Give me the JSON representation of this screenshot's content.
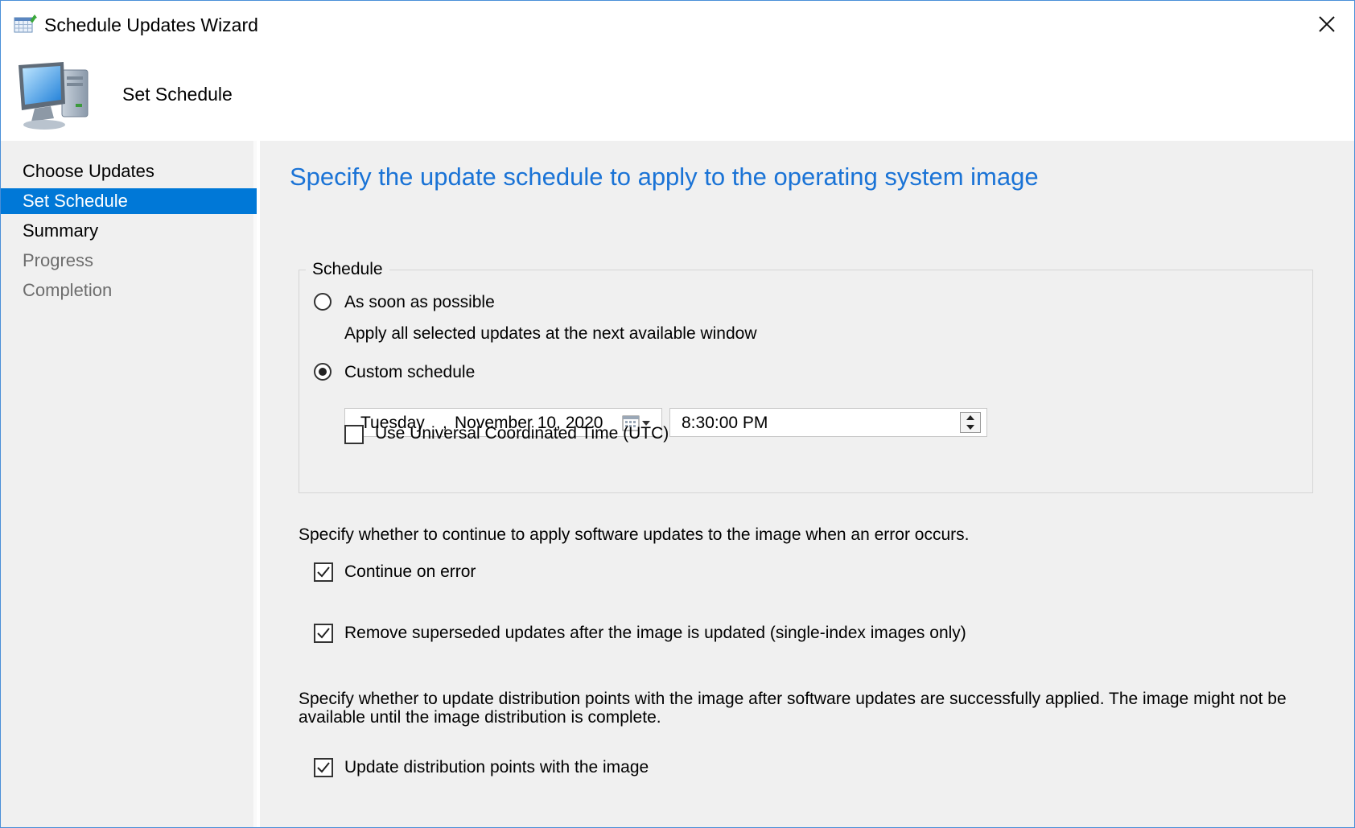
{
  "window": {
    "title": "Schedule Updates Wizard",
    "close_icon": "close-icon"
  },
  "header": {
    "title": "Set Schedule",
    "icon": "computer-icon"
  },
  "sidebar": {
    "items": [
      {
        "label": "Choose Updates",
        "state": "normal"
      },
      {
        "label": "Set Schedule",
        "state": "active"
      },
      {
        "label": "Summary",
        "state": "normal"
      },
      {
        "label": "Progress",
        "state": "disabled"
      },
      {
        "label": "Completion",
        "state": "disabled"
      }
    ]
  },
  "main": {
    "heading": "Specify the update schedule to apply to the operating system image",
    "schedule_group": {
      "legend": "Schedule",
      "asap_label": "As soon as possible",
      "asap_checked": false,
      "asap_description": "Apply all selected updates at the next available window",
      "custom_label": "Custom schedule",
      "custom_checked": true,
      "date": {
        "day": "Tuesday",
        "comma": ",",
        "rest": "November 10, 2020"
      },
      "time": "8:30:00 PM",
      "utc_label": "Use Universal Coordinated Time (UTC)",
      "utc_checked": false
    },
    "error_description": "Specify whether to continue to apply software updates to the image when an error occurs.",
    "continue_on_error_label": "Continue on error",
    "continue_on_error_checked": true,
    "remove_superseded_label": "Remove superseded updates after the image is updated (single-index images only)",
    "remove_superseded_checked": true,
    "dp_description_line1": "Specify whether to update distribution points with the image after software updates are successfully applied. The image might not be",
    "dp_description_line2": "available until the image distribution is complete.",
    "update_dp_label": "Update distribution points with the image",
    "update_dp_checked": true
  },
  "colors": {
    "accent": "#0078d7",
    "heading": "#1a73d6",
    "panel_bg": "#f0f0f0"
  }
}
